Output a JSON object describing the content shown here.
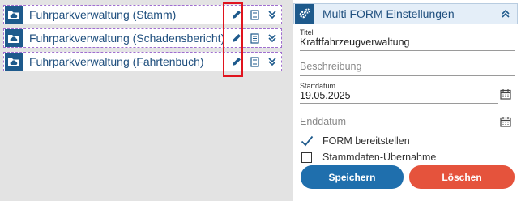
{
  "forms": [
    {
      "label": "Fuhrparkverwaltung (Stamm)"
    },
    {
      "label": "Fuhrparkverwaltung (Schadensbericht)"
    },
    {
      "label": "Fuhrparkverwaltung (Fahrtenbuch)"
    }
  ],
  "panel": {
    "title": "Multi FORM Einstellungen",
    "fields": {
      "titel_label": "Titel",
      "titel_value": "Kraftfahrzeugverwaltung",
      "beschreibung_placeholder": "Beschreibung",
      "startdatum_label": "Startdatum",
      "startdatum_value": "19.05.2025",
      "enddatum_placeholder": "Enddatum"
    },
    "checks": {
      "bereitstellen_label": "FORM bereitstellen",
      "bereitstellen_checked": true,
      "stammdaten_label": "Stammdaten-Übernahme",
      "stammdaten_checked": false
    },
    "buttons": {
      "save_label": "Speichern",
      "delete_label": "Löschen"
    }
  },
  "colors": {
    "primary": "#1e5a8c",
    "save": "#1f6fad",
    "delete": "#e5533c",
    "highlight": "#e0141e"
  },
  "icons": {
    "form_icon": "folder-cloud-icon",
    "edit_icon": "pencil-icon",
    "doc_icon": "document-list-icon",
    "expand_icon": "double-chevron-down-icon",
    "panel_icon": "gears-icon",
    "collapse_icon": "double-chevron-up-icon",
    "date_icon": "calendar-icon"
  }
}
